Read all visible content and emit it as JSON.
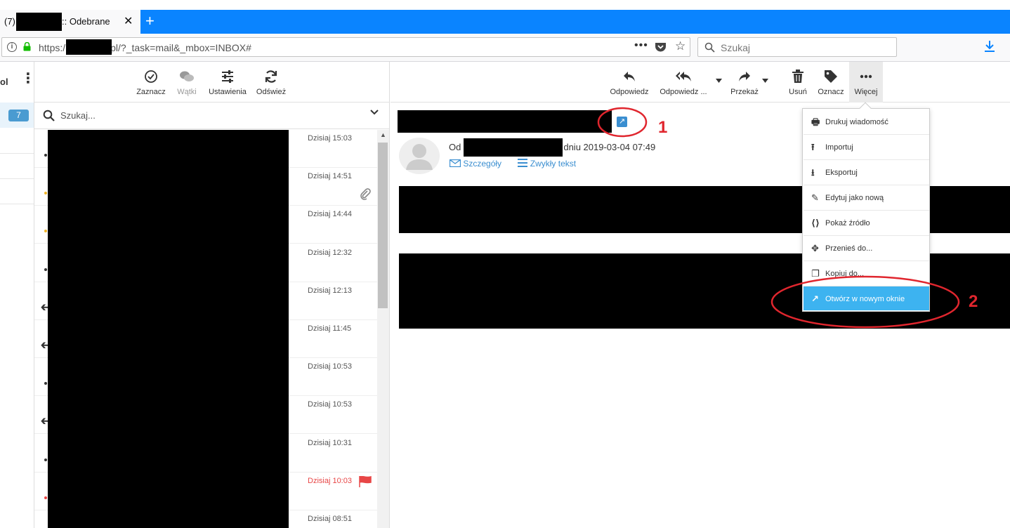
{
  "browser": {
    "tab": {
      "count": "(7)",
      "title": ":: Odebrane",
      "close": "✕"
    },
    "new_tab": "+",
    "url": {
      "prefix": "https:/",
      "suffix": "pl/?_task=mail&_mbox=INBOX#"
    },
    "page_actions": "•••",
    "search_placeholder": "Szukaj"
  },
  "folders": {
    "cut_label": "ol",
    "badge": "7"
  },
  "list_toolbar": {
    "select": "Zaznacz",
    "threads": "Wątki",
    "settings": "Ustawienia",
    "refresh": "Odśwież"
  },
  "list_search": {
    "placeholder": "Szukaj..."
  },
  "messages": [
    {
      "date": "Dzisiaj 15:03",
      "marker": "dot",
      "marker_color": "#333333"
    },
    {
      "date": "Dzisiaj 14:51",
      "marker": "dot",
      "marker_color": "#f0b429",
      "attachment": true
    },
    {
      "date": "Dzisiaj 14:44",
      "marker": "dot",
      "marker_color": "#f0b429"
    },
    {
      "date": "Dzisiaj 12:32",
      "marker": "dot",
      "marker_color": "#333333"
    },
    {
      "date": "Dzisiaj 12:13",
      "marker": "reply",
      "marker_color": "#333333"
    },
    {
      "date": "Dzisiaj 11:45",
      "marker": "reply",
      "marker_color": "#333333"
    },
    {
      "date": "Dzisiaj 10:53",
      "marker": "dot",
      "marker_color": "#333333"
    },
    {
      "date": "Dzisiaj 10:53",
      "marker": "reply",
      "marker_color": "#333333"
    },
    {
      "date": "Dzisiaj 10:31",
      "marker": "dot",
      "marker_color": "#333333"
    },
    {
      "date": "Dzisiaj 10:03",
      "marker": "dot",
      "marker_color": "#e84646",
      "flagged": true
    },
    {
      "date": "Dzisiaj 08:51",
      "marker": "dot",
      "marker_color": "#333333"
    }
  ],
  "message_toolbar": {
    "reply": "Odpowiedz",
    "reply_all": "Odpowiedz ...",
    "forward": "Przekaż",
    "delete": "Usuń",
    "mark": "Oznacz",
    "more": "Więcej"
  },
  "message": {
    "from_prefix": "Od",
    "from_suffix": "dniu 2019-03-04 07:49",
    "details": "Szczegóły",
    "plain_text": "Zwykły tekst"
  },
  "more_menu": [
    {
      "label": "Drukuj wiadomość",
      "icon": "print-icon"
    },
    {
      "label": "Importuj",
      "icon": "import-icon"
    },
    {
      "label": "Eksportuj",
      "icon": "export-icon"
    },
    {
      "label": "Edytuj jako nową",
      "icon": "edit-icon"
    },
    {
      "label": "Pokaż źródło",
      "icon": "source-icon"
    },
    {
      "label": "Przenieś do...",
      "icon": "move-icon"
    },
    {
      "label": "Kopiuj do...",
      "icon": "copy-icon"
    },
    {
      "label": "Otwórz w nowym oknie",
      "icon": "open-new-window-icon",
      "active": true
    }
  ],
  "annotations": {
    "first": "1",
    "second": "2"
  },
  "colors": {
    "accent": "#3a8ed0",
    "menu_active": "#3db3f0",
    "annotation": "#e0262e",
    "tabbar": "#0a84ff"
  }
}
